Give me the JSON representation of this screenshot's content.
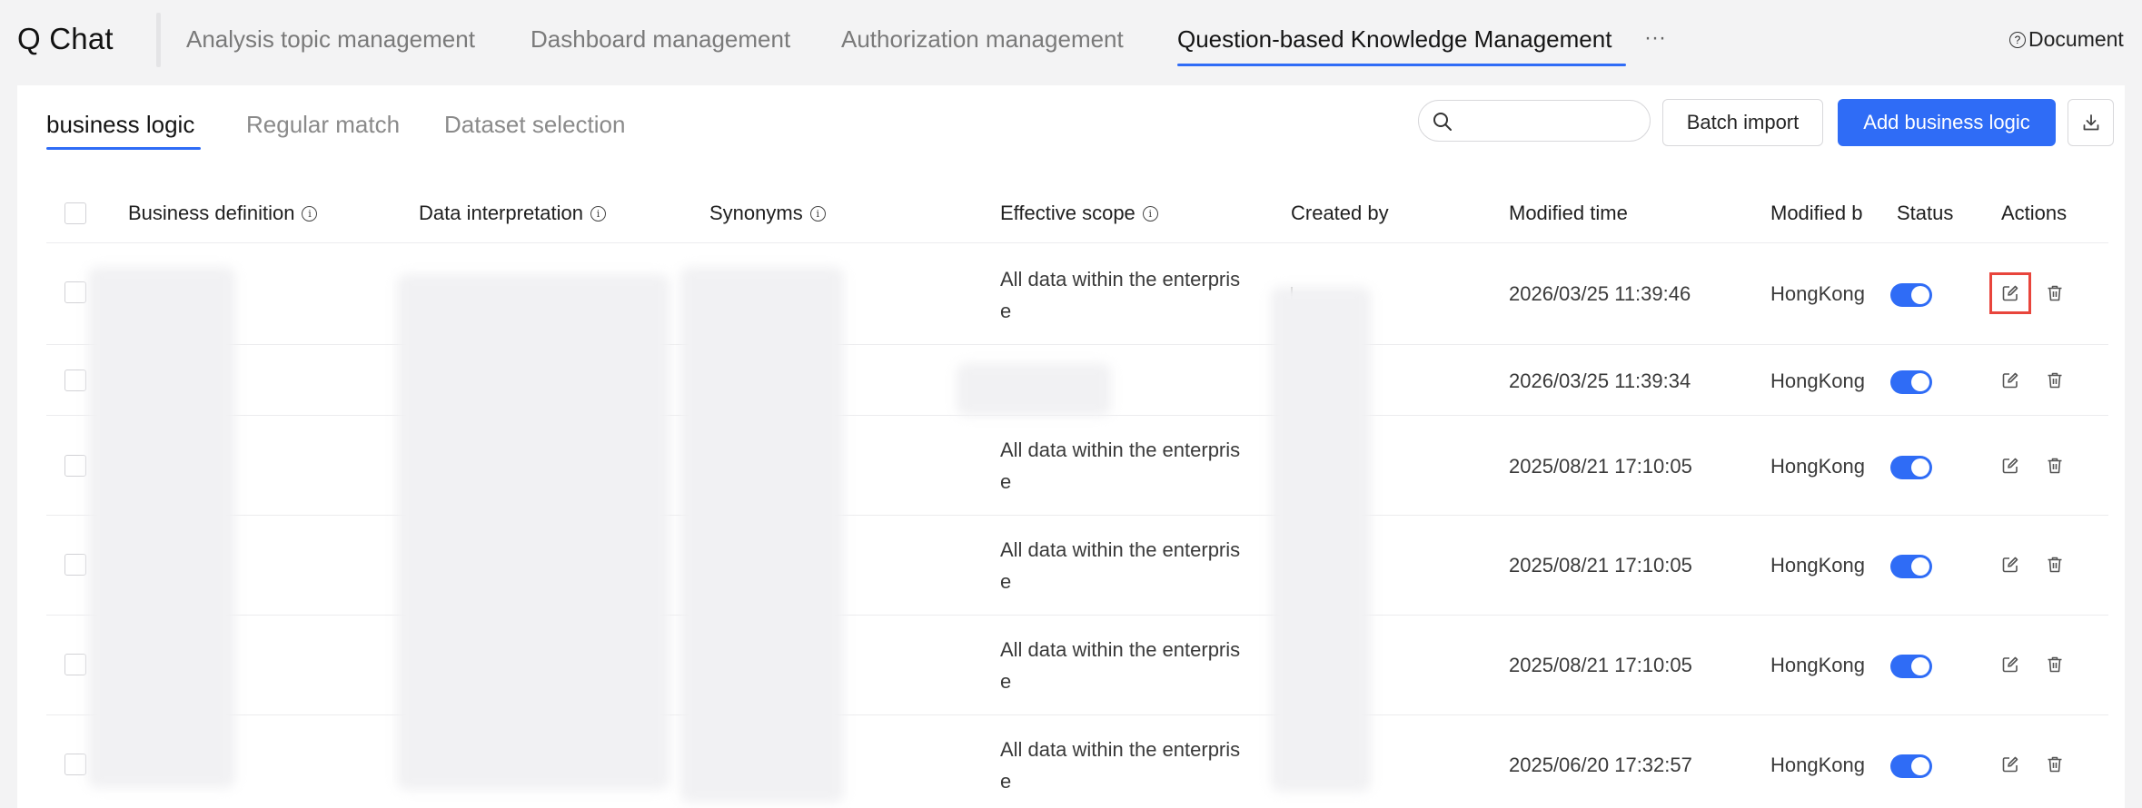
{
  "app": {
    "title": "Q Chat"
  },
  "nav": {
    "tabs": [
      "Analysis topic management",
      "Dashboard management",
      "Authorization management",
      "Question-based Knowledge Management"
    ],
    "more": "···",
    "document_label": "Document",
    "document_icon": "?"
  },
  "subtabs": [
    "business logic",
    "Regular match",
    "Dataset selection"
  ],
  "toolbar": {
    "search_placeholder": "",
    "batch_import": "Batch import",
    "add_button": "Add business logic"
  },
  "table": {
    "headers": {
      "business_definition": "Business definition",
      "data_interpretation": "Data interpretation",
      "synonyms": "Synonyms",
      "effective_scope": "Effective scope",
      "created_by": "Created by",
      "modified_time": "Modified time",
      "modified_by": "Modified b",
      "status": "Status",
      "actions": "Actions"
    },
    "info_glyph": "i",
    "rows": [
      {
        "scope_line1": "All data within the enterpris",
        "scope_line2": "e",
        "modified_time": "2026/03/25 11:39:46",
        "modified_by": "HongKong",
        "status": "on"
      },
      {
        "scope_line1": "",
        "scope_line2": "",
        "modified_time": "2026/03/25 11:39:34",
        "modified_by": "HongKong",
        "status": "on"
      },
      {
        "scope_line1": "All data within the enterpris",
        "scope_line2": "e",
        "modified_time": "2025/08/21 17:10:05",
        "modified_by": "HongKong",
        "status": "on"
      },
      {
        "scope_line1": "All data within the enterpris",
        "scope_line2": "e",
        "modified_time": "2025/08/21 17:10:05",
        "modified_by": "HongKong",
        "status": "on"
      },
      {
        "scope_line1": "All data within the enterpris",
        "scope_line2": "e",
        "modified_time": "2025/08/21 17:10:05",
        "modified_by": "HongKong",
        "status": "on"
      },
      {
        "scope_line1": "All data within the enterpris",
        "scope_line2": "e",
        "modified_time": "2025/06/20 17:32:57",
        "modified_by": "HongKong",
        "status": "on"
      }
    ]
  },
  "colors": {
    "accent": "#2f6cf6",
    "highlight": "#e8453c"
  }
}
